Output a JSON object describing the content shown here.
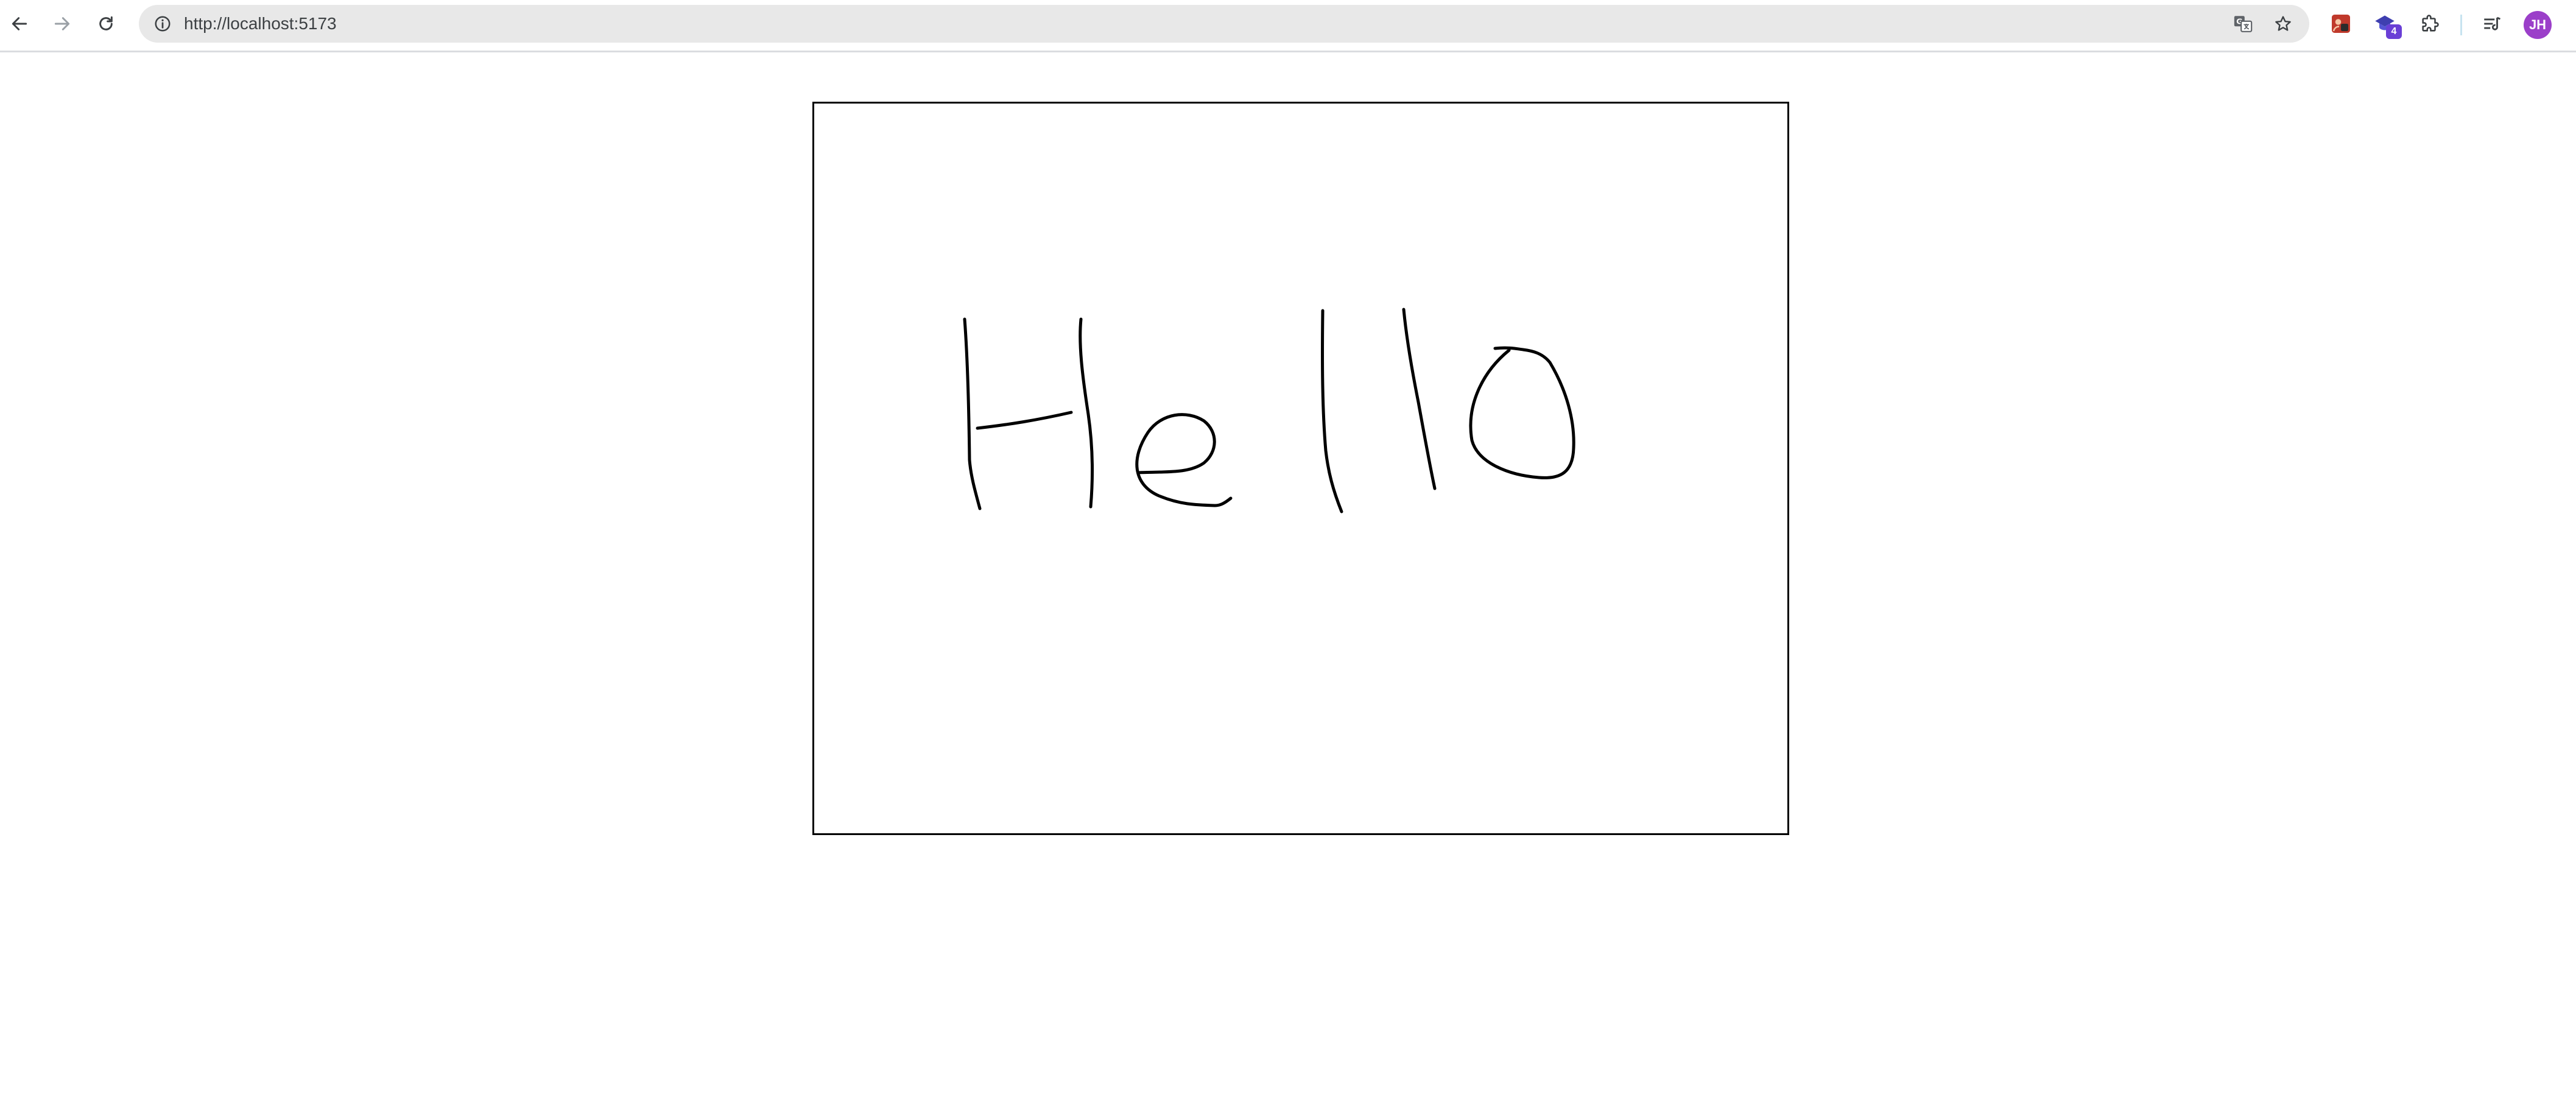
{
  "browser": {
    "address_bar": {
      "url": "http://localhost:5173"
    },
    "icons": {
      "back": "back-arrow-icon",
      "forward": "forward-arrow-icon",
      "reload": "reload-icon",
      "site_info": "info-icon",
      "translate": "translate-icon",
      "bookmark": "star-icon",
      "extensions": "puzzle-icon",
      "reading_list": "reading-list-icon"
    },
    "extension_badge": "4",
    "profile": {
      "initials": "JH",
      "color": "#9b3fc9"
    }
  },
  "canvas": {
    "stroke_color": "#000000",
    "border_color": "#000000"
  }
}
